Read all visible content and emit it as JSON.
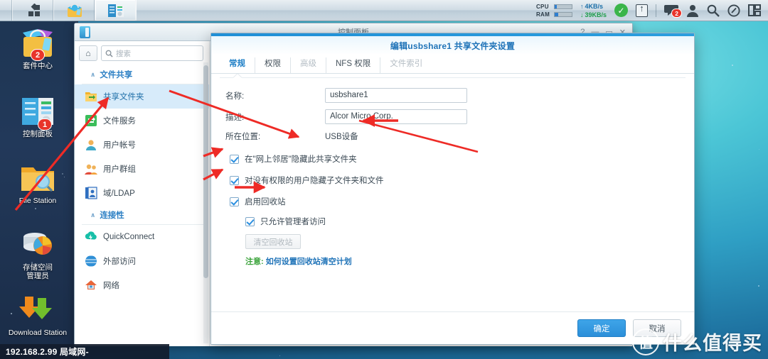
{
  "taskbar": {
    "items": [
      {
        "name": "main-menu",
        "icon": "grid-menu-icon"
      },
      {
        "name": "package-center",
        "icon": "package-center-icon"
      },
      {
        "name": "control-panel",
        "icon": "control-panel-icon"
      }
    ],
    "cpu_label": "CPU",
    "ram_label": "RAM",
    "upload_speed": "4KB/s",
    "download_speed": "39KB/s",
    "upload_arrow": "↑",
    "download_arrow": "↓",
    "notification_badge": "2",
    "icons": [
      "notification-bell-icon",
      "user-icon",
      "search-icon",
      "help-icon",
      "widgets-icon"
    ]
  },
  "desktop": {
    "icons": [
      {
        "label": "套件中心",
        "badge": "2",
        "name": "package-center"
      },
      {
        "label": "控制面板",
        "badge": "1",
        "name": "control-panel"
      },
      {
        "label": "File Station",
        "badge": "",
        "name": "file-station"
      },
      {
        "label": "存储空间\n管理员",
        "badge": "",
        "name": "storage-manager"
      },
      {
        "label": "Download Station",
        "badge": "",
        "name": "download-station"
      }
    ]
  },
  "statusbar": {
    "text": "192.168.2.99 局域网-"
  },
  "watermark": {
    "mark": "值",
    "text": "什么值得买"
  },
  "control_panel": {
    "window_title": "控制面板",
    "window_controls": [
      "?",
      "—",
      "▭",
      "✕"
    ],
    "home_icon": "home-icon",
    "search_placeholder": "搜索",
    "search_value": "",
    "groups": [
      {
        "label": "文件共享",
        "items": [
          {
            "label": "共享文件夹",
            "icon": "shared-folder-icon",
            "selected": true
          },
          {
            "label": "文件服务",
            "icon": "file-services-icon",
            "selected": false
          },
          {
            "label": "用户帐号",
            "icon": "user-account-icon",
            "selected": false
          },
          {
            "label": "用户群组",
            "icon": "user-group-icon",
            "selected": false
          },
          {
            "label": "域/LDAP",
            "icon": "domain-ldap-icon",
            "selected": false
          }
        ]
      },
      {
        "label": "连接性",
        "items": [
          {
            "label": "QuickConnect",
            "icon": "quickconnect-icon",
            "selected": false
          },
          {
            "label": "外部访问",
            "icon": "external-access-icon",
            "selected": false
          },
          {
            "label": "网络",
            "icon": "network-icon",
            "selected": false
          }
        ]
      }
    ]
  },
  "dialog": {
    "title": "编辑usbshare1 共享文件夹设置",
    "tabs": [
      {
        "label": "常规",
        "active": true,
        "disabled": false
      },
      {
        "label": "权限",
        "active": false,
        "disabled": false
      },
      {
        "label": "高级",
        "active": false,
        "disabled": true
      },
      {
        "label": "NFS 权限",
        "active": false,
        "disabled": false
      },
      {
        "label": "文件索引",
        "active": false,
        "disabled": true
      }
    ],
    "fields": [
      {
        "label": "名称:",
        "value": "usbshare1",
        "type": "input"
      },
      {
        "label": "描述:",
        "value": "Alcor Micro Corp.",
        "type": "input"
      },
      {
        "label": "所在位置:",
        "value": "USB设备",
        "type": "text"
      }
    ],
    "checkboxes": [
      {
        "label": "在\"网上邻居\"隐藏此共享文件夹",
        "checked": true,
        "indent": false
      },
      {
        "label": "对没有权限的用户隐藏子文件夹和文件",
        "checked": true,
        "indent": false
      },
      {
        "label": "启用回收站",
        "checked": true,
        "indent": false
      },
      {
        "label": "只允许管理者访问",
        "checked": true,
        "indent": true
      }
    ],
    "empty_recycle_button": "清空回收站",
    "note_prefix": "注意:",
    "note_link": "如何设置回收站清空计划",
    "ok_button": "确定",
    "cancel_button": "取消"
  },
  "colors": {
    "accent": "#2b8fd9",
    "title_blue": "#1f73b8",
    "selected_row": "#d7ebfa",
    "arrow_red": "#ee2b26",
    "badge_red": "#e8342b",
    "green": "#3aa33a"
  }
}
